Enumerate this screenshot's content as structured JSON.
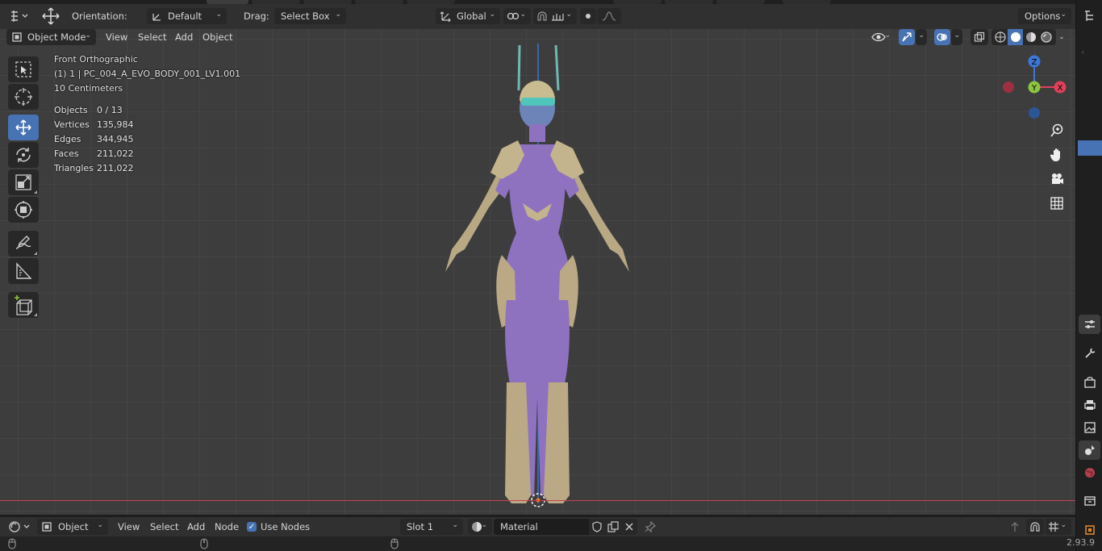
{
  "top_header": {
    "orientation_label": "Orientation:",
    "orientation_value": "Default",
    "drag_label": "Drag:",
    "drag_value": "Select Box",
    "transform_space": "Global",
    "options_label": "Options"
  },
  "viewport_header": {
    "mode": "Object Mode",
    "menu": [
      "View",
      "Select",
      "Add",
      "Object"
    ]
  },
  "overlay": {
    "view_name": "Front Orthographic",
    "object_name": "(1) 1 | PC_004_A_EVO_BODY_001_LV1.001",
    "scale": "10 Centimeters",
    "stats": [
      {
        "label": "Objects",
        "value": "0 / 13"
      },
      {
        "label": "Vertices",
        "value": "135,984"
      },
      {
        "label": "Edges",
        "value": "344,945"
      },
      {
        "label": "Faces",
        "value": "211,022"
      },
      {
        "label": "Triangles",
        "value": "211,022"
      }
    ]
  },
  "gizmo": {
    "z": "Z",
    "y": "Y",
    "x": "X"
  },
  "bottom_header": {
    "object_label": "Object",
    "menu": [
      "View",
      "Select",
      "Add",
      "Node"
    ],
    "use_nodes_label": "Use Nodes",
    "slot_label": "Slot 1",
    "material_name": "Material"
  },
  "version": "2.93.9",
  "colors": {
    "grid_bg": "#3d3d3d",
    "accent": "#4772b3",
    "suit": "#8e72c0",
    "armor": "#bcab8a",
    "x_axis": "#e0405a",
    "y_axis": "#8bc63e",
    "z_axis": "#3b78d8"
  },
  "icons": [
    "editor-type-icon",
    "move-icon",
    "transform-orientation-icon",
    "snap-icon",
    "proportional-icon",
    "visibility-icon",
    "gizmo-icon",
    "overlay-icon",
    "xray-icon",
    "wireframe-icon",
    "solid-icon",
    "material-preview-icon",
    "rendered-icon",
    "zoom-icon",
    "hand-icon",
    "camera-icon",
    "grid-icon"
  ]
}
